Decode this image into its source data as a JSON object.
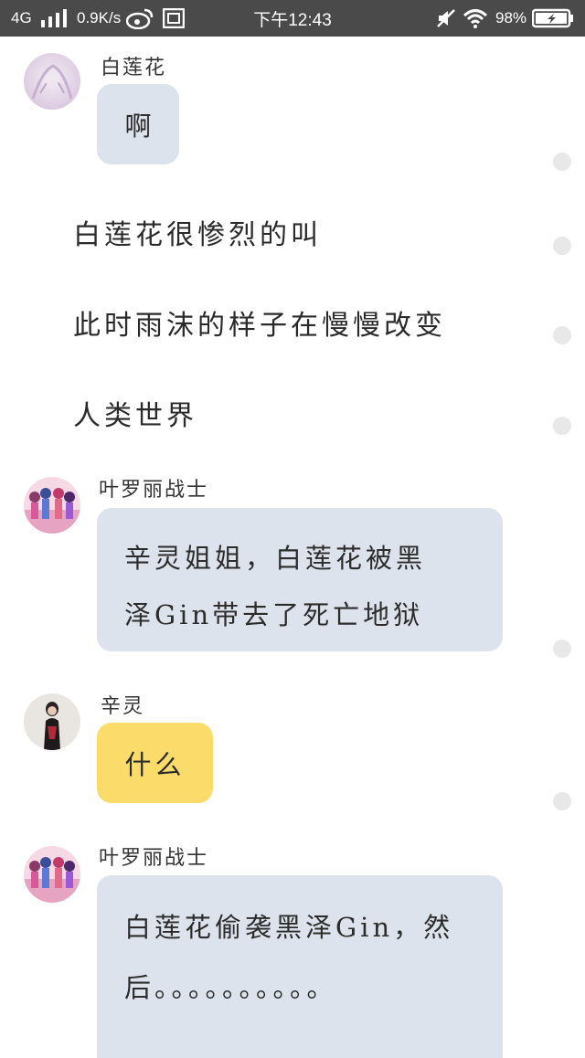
{
  "status_bar": {
    "network": "4G",
    "speed": "0.9K/s",
    "time": "下午12:43",
    "battery": "98%",
    "icons": [
      "signal-bars-icon",
      "weibo-icon",
      "sim-card-icon",
      "mute-icon",
      "wifi-icon",
      "battery-charging-icon"
    ]
  },
  "messages": [
    {
      "sender": "白莲花",
      "text": "啊",
      "bubble_color": "#dde3ec"
    },
    {
      "sender": "叶罗丽战士",
      "lines": [
        "辛灵姐姐，白莲花被黑",
        "泽Gin带去了死亡地狱"
      ],
      "bubble_color": "#dde3ec"
    },
    {
      "sender": "辛灵",
      "text": "什么",
      "bubble_color": "#fbdc6b"
    },
    {
      "sender": "叶罗丽战士",
      "lines": [
        "白莲花偷袭黑泽Gin，然",
        "后。。。。。。。。。。"
      ],
      "bubble_color": "#dde3ec"
    }
  ],
  "narration": [
    "白莲花很惨烈的叫",
    "此时雨沫的样子在慢慢改变",
    "人类世界"
  ],
  "colors": {
    "status_bar_bg": "#4a4a4a",
    "bubble_grey": "#dde3ec",
    "bubble_yellow": "#fbdc6b",
    "side_dot": "#e8e8e8"
  }
}
